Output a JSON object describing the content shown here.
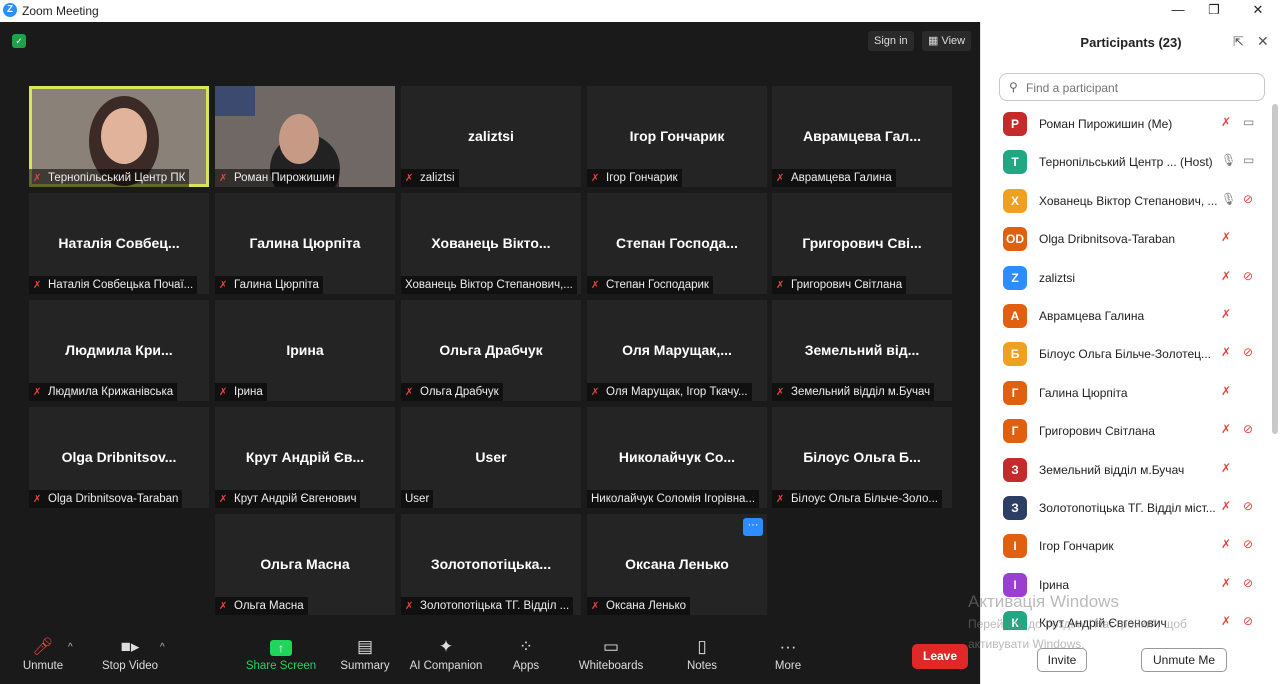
{
  "window": {
    "title": "Zoom Meeting",
    "logo_letter": "Z"
  },
  "top_bar": {
    "sign_in": "Sign in",
    "view": "View"
  },
  "tiles": [
    {
      "label": "Тернопільський Центр ПК",
      "has_video": true,
      "active": true
    },
    {
      "label": "Роман Пирожишин",
      "has_video": true
    },
    {
      "name": "zaliztsi",
      "label": "zaliztsi"
    },
    {
      "name": "Ігор Гончарик",
      "label": "Ігор Гончарик"
    },
    {
      "name": "Аврамцева Гал...",
      "label": "Аврамцева Галина"
    },
    {
      "name": "Наталія Совбец...",
      "label": "Наталія Совбецька Почаї..."
    },
    {
      "name": "Галина Цюрпіта",
      "label": "Галина Цюрпіта"
    },
    {
      "name": "Хованець Вікто...",
      "label": "Хованець Віктор Степанович,...",
      "no_mic_icon": true
    },
    {
      "name": "Степан Господа...",
      "label": "Степан Господарик"
    },
    {
      "name": "Григорович Сві...",
      "label": "Григорович Світлана"
    },
    {
      "name": "Людмила Кри...",
      "label": "Людмила Крижанівська"
    },
    {
      "name": "Ірина",
      "label": "Ірина"
    },
    {
      "name": "Ольга Драбчук",
      "label": "Ольга Драбчук"
    },
    {
      "name": "Оля Марущак,...",
      "label": "Оля Марущак, Ігор Ткачу..."
    },
    {
      "name": "Земельний від...",
      "label": "Земельний відділ м.Бучач"
    },
    {
      "name": "Olga Dribnitsov...",
      "label": "Olga Dribnitsova-Taraban"
    },
    {
      "name": "Крут Андрій Єв...",
      "label": "Крут Андрій Євгенович"
    },
    {
      "name": "User",
      "label": "User",
      "no_mic_icon": true
    },
    {
      "name": "Николайчук Со...",
      "label": "Николайчук Соломія Ігорівна...",
      "no_mic_icon": true
    },
    {
      "name": "Білоус Ольга Б...",
      "label": "Білоус Ольга Більче-Золо..."
    },
    {
      "name": "Ольга Масна",
      "label": "Ольга Масна"
    },
    {
      "name": "Золотопотіцька...",
      "label": "Золотопотіцька ТГ. Відділ ..."
    },
    {
      "name": "Оксана Ленько",
      "label": "Оксана Ленько",
      "more_button": "···"
    }
  ],
  "toolbar": {
    "unmute": "Unmute",
    "stop_video": "Stop Video",
    "share_screen": "Share Screen",
    "summary": "Summary",
    "ai_companion": "AI Companion",
    "apps": "Apps",
    "whiteboards": "Whiteboards",
    "notes": "Notes",
    "more": "More",
    "leave": "Leave",
    "share_color": "#1fd65a",
    "leave_color": "#e02828"
  },
  "participants": {
    "title": "Participants (23)",
    "search_placeholder": "Find a participant",
    "invite": "Invite",
    "unmute_me": "Unmute Me",
    "list": [
      {
        "initials": "Р",
        "name": "Роман Пирожишин (Me)",
        "color": "#c62b2b",
        "mic": "off",
        "cam": "on"
      },
      {
        "initials": "Т",
        "name": "Тернопільський Центр ... (Host)",
        "color": "#1fa882",
        "mic": "on",
        "cam": "on"
      },
      {
        "initials": "Х",
        "name": "Хованець Віктор Степанович, ...",
        "color": "#f0a020",
        "mic": "on",
        "cam": "off"
      },
      {
        "initials": "OD",
        "name": "Olga Dribnitsova-Taraban",
        "color": "#e06010",
        "mic": "off",
        "cam": "none"
      },
      {
        "initials": "Z",
        "name": "zaliztsi",
        "color": "#2d8cff",
        "mic": "off",
        "cam": "off"
      },
      {
        "initials": "А",
        "name": "Аврамцева Галина",
        "color": "#e06010",
        "mic": "off",
        "cam": "none"
      },
      {
        "initials": "Б",
        "name": "Білоус Ольга Більче-Золотец...",
        "color": "#f0a020",
        "mic": "off",
        "cam": "off"
      },
      {
        "initials": "Г",
        "name": "Галина Цюрпіта",
        "color": "#e06010",
        "mic": "off",
        "cam": "none"
      },
      {
        "initials": "Г",
        "name": "Григорович Світлана",
        "color": "#e06010",
        "mic": "off",
        "cam": "off"
      },
      {
        "initials": "З",
        "name": "Земельний відділ м.Бучач",
        "color": "#c62b2b",
        "mic": "off",
        "cam": "none"
      },
      {
        "initials": "З",
        "name": "Золотопотіцька ТГ. Відділ міст...",
        "color": "#2c3e66",
        "mic": "off",
        "cam": "off"
      },
      {
        "initials": "І",
        "name": "Ігор Гончарик",
        "color": "#e06010",
        "mic": "off",
        "cam": "off"
      },
      {
        "initials": "І",
        "name": "Ірина",
        "color": "#9b3fd0",
        "mic": "off",
        "cam": "off"
      },
      {
        "initials": "К",
        "name": "Крут Андрій Євгенович",
        "color": "#1fa882",
        "mic": "off",
        "cam": "off"
      }
    ]
  },
  "watermark": {
    "line1": "Активація Windows",
    "line2": "Перейдіть до розділу \"Настройки\", щоб",
    "line3": "активувати Windows."
  }
}
